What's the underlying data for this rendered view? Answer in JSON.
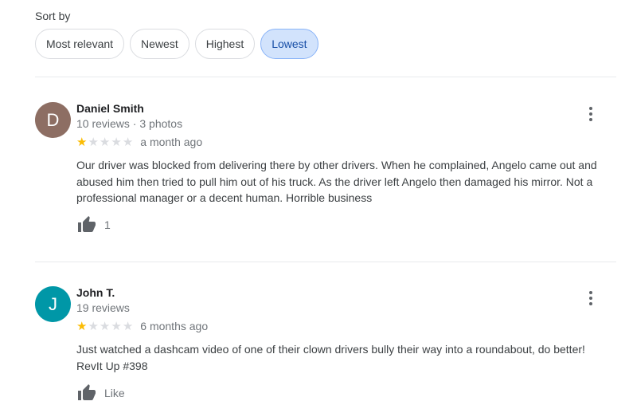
{
  "sort": {
    "label": "Sort by",
    "options": [
      {
        "label": "Most relevant",
        "selected": false
      },
      {
        "label": "Newest",
        "selected": false
      },
      {
        "label": "Highest",
        "selected": false
      },
      {
        "label": "Lowest",
        "selected": true
      }
    ]
  },
  "colors": {
    "selected_chip_bg": "#d2e3fc",
    "star_filled": "#fbbc04",
    "star_empty": "#dadce0"
  },
  "reviews": [
    {
      "initial": "D",
      "avatar_color": "#8d6e63",
      "name": "Daniel Smith",
      "meta": "10 reviews · 3 photos",
      "rating": 1,
      "max_rating": 5,
      "time": "a month ago",
      "text": "Our driver was blocked from delivering there by other drivers. When he complained, Angelo came out and abused him then tried to pull him out of his truck. As the driver left Angelo then damaged his mirror. Not a professional manager or a decent human. Horrible business",
      "like_label": "1",
      "icons": {
        "more": "more-vert-icon",
        "like": "thumb-up-icon"
      }
    },
    {
      "initial": "J",
      "avatar_color": "#0097a7",
      "name": "John T.",
      "meta": "19 reviews",
      "rating": 1,
      "max_rating": 5,
      "time": "6 months ago",
      "text": "Just watched a dashcam video of one of their clown drivers bully their way into a roundabout, do better! RevIt Up #398",
      "like_label": "Like",
      "icons": {
        "more": "more-vert-icon",
        "like": "thumb-up-icon"
      }
    }
  ]
}
